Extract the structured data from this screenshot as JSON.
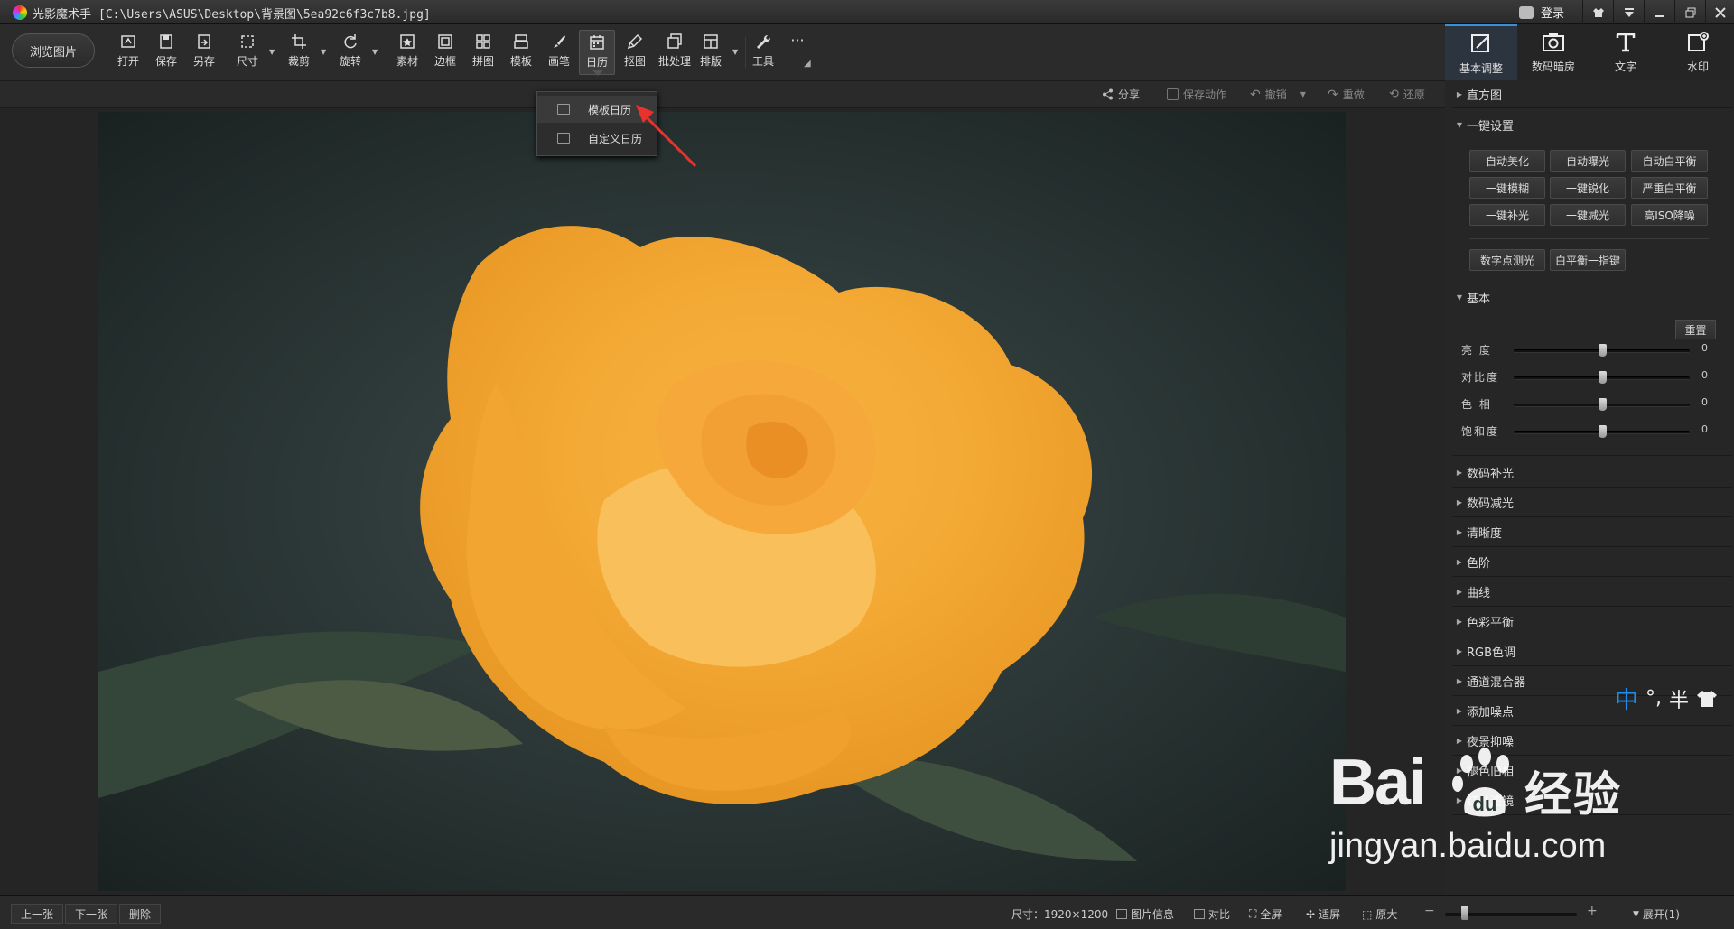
{
  "titlebar": {
    "app_name": "光影魔术手",
    "file_path": "[C:\\Users\\ASUS\\Desktop\\背景图\\5ea92c6f3c7b8.jpg]",
    "login_label": "登录"
  },
  "toolbar": {
    "browse_label": "浏览图片",
    "tools": [
      {
        "label": "打开",
        "icon": "open-icon"
      },
      {
        "label": "保存",
        "icon": "save-icon"
      },
      {
        "label": "另存",
        "icon": "save-as-icon"
      },
      {
        "label": "尺寸",
        "icon": "resize-icon"
      },
      {
        "label": "裁剪",
        "icon": "crop-icon"
      },
      {
        "label": "旋转",
        "icon": "rotate-icon"
      },
      {
        "label": "素材",
        "icon": "material-icon"
      },
      {
        "label": "边框",
        "icon": "border-icon"
      },
      {
        "label": "拼图",
        "icon": "collage-icon"
      },
      {
        "label": "模板",
        "icon": "template-icon"
      },
      {
        "label": "画笔",
        "icon": "brush-icon"
      },
      {
        "label": "日历",
        "icon": "calendar-icon"
      },
      {
        "label": "抠图",
        "icon": "cutout-icon"
      },
      {
        "label": "批处理",
        "icon": "batch-icon"
      },
      {
        "label": "排版",
        "icon": "layout-icon"
      },
      {
        "label": "工具",
        "icon": "tools-icon"
      }
    ],
    "more_label": "···"
  },
  "right_tabs": [
    {
      "label": "基本调整",
      "icon": "adjust-icon",
      "active": true
    },
    {
      "label": "数码暗房",
      "icon": "darkroom-icon",
      "active": false
    },
    {
      "label": "文字",
      "icon": "text-icon",
      "active": false
    },
    {
      "label": "水印",
      "icon": "watermark-icon",
      "active": false
    }
  ],
  "subbar": {
    "share": "分享",
    "save_action": "保存动作",
    "undo": "撤销",
    "redo": "重做",
    "restore": "还原"
  },
  "calendar_menu": {
    "items": [
      "模板日历",
      "自定义日历"
    ]
  },
  "panel": {
    "histogram": "直方图",
    "one_click": "一键设置",
    "one_click_buttons": [
      "自动美化",
      "自动曝光",
      "自动白平衡",
      "一键模糊",
      "一键锐化",
      "严重白平衡",
      "一键补光",
      "一键减光",
      "高ISO降噪"
    ],
    "extra_buttons": [
      "数字点测光",
      "白平衡一指键"
    ],
    "basic": "基本",
    "reset": "重置",
    "sliders": [
      {
        "label": "亮  度",
        "value": "0",
        "level": 0.5
      },
      {
        "label": "对比度",
        "value": "0",
        "level": 0.5
      },
      {
        "label": "色  相",
        "value": "0",
        "level": 0.5
      },
      {
        "label": "饱和度",
        "value": "0",
        "level": 0.5
      }
    ],
    "sections": [
      "数码补光",
      "数码减光",
      "清晰度",
      "色阶",
      "曲线",
      "色彩平衡",
      "RGB色调",
      "通道混合器",
      "添加噪点",
      "夜景抑噪",
      "褪色旧相",
      "红外滤镜"
    ]
  },
  "statusbar": {
    "prev": "上一张",
    "next": "下一张",
    "delete": "删除",
    "size": "尺寸：1920×1200",
    "info": "图片信息",
    "compare": "对比",
    "fullscreen": "全屏",
    "fit": "适屏",
    "original": "原大",
    "expand": "展开(1)",
    "zoom_level": 0.15
  },
  "ime": {
    "zh": "中",
    "c1": "°,",
    "c2": "半"
  },
  "watermark": {
    "bai": "Bai",
    "du": "du",
    "jy": "经验",
    "url": "jingyan.baidu.com"
  },
  "colors": {
    "accent": "#3a8fd9",
    "arrow": "#e8322e",
    "rose": "#f4a935"
  }
}
